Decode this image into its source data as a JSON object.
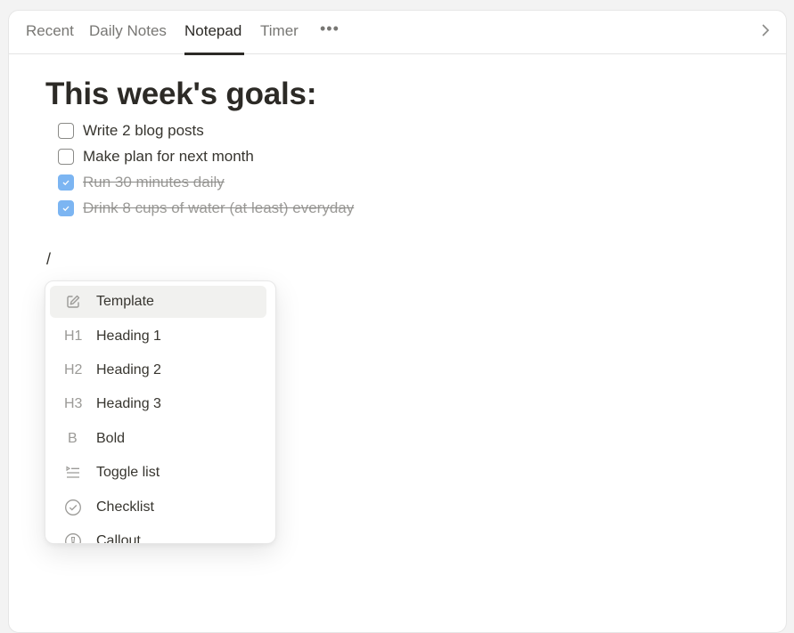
{
  "tabs": [
    {
      "label": "Recent",
      "active": false
    },
    {
      "label": "Daily Notes",
      "active": false
    },
    {
      "label": "Notepad",
      "active": true
    },
    {
      "label": "Timer",
      "active": false
    }
  ],
  "more_label": "•••",
  "note": {
    "heading": "This week's goals:",
    "todos": [
      {
        "text": "Write 2 blog posts",
        "checked": false
      },
      {
        "text": "Make plan for next month",
        "checked": false
      },
      {
        "text": "Run 30 minutes daily",
        "checked": true
      },
      {
        "text": "Drink 8 cups of water (at least) everyday",
        "checked": true
      }
    ],
    "current_input": "/"
  },
  "slash_menu": {
    "items": [
      {
        "icon": "edit-icon",
        "glyph": "",
        "label": "Template",
        "highlighted": true
      },
      {
        "icon": "heading1-icon",
        "glyph": "H1",
        "label": "Heading 1",
        "highlighted": false
      },
      {
        "icon": "heading2-icon",
        "glyph": "H2",
        "label": "Heading 2",
        "highlighted": false
      },
      {
        "icon": "heading3-icon",
        "glyph": "H3",
        "label": "Heading 3",
        "highlighted": false
      },
      {
        "icon": "bold-icon",
        "glyph": "B",
        "label": "Bold",
        "highlighted": false
      },
      {
        "icon": "toggle-list-icon",
        "glyph": "",
        "label": "Toggle list",
        "highlighted": false
      },
      {
        "icon": "checklist-icon",
        "glyph": "",
        "label": "Checklist",
        "highlighted": false
      },
      {
        "icon": "callout-icon",
        "glyph": "",
        "label": "Callout",
        "highlighted": false
      }
    ]
  },
  "colors": {
    "accent_checkbox": "#7cb5f2",
    "text_primary": "#37352f",
    "text_muted": "#787774"
  }
}
